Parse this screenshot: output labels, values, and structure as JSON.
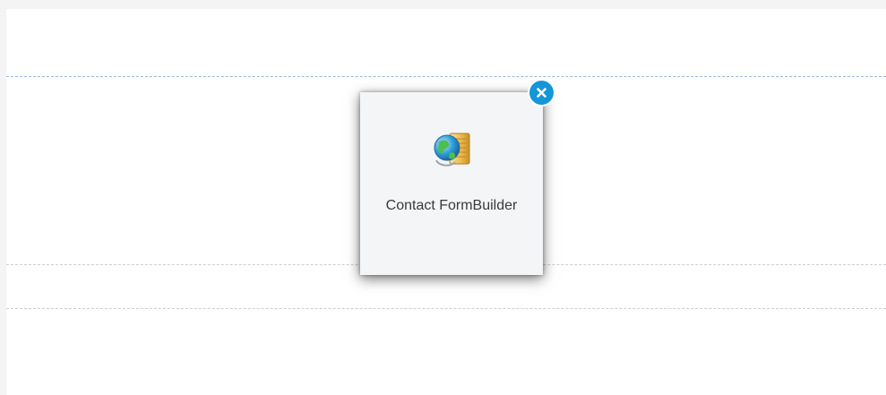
{
  "workspace": {
    "tile": {
      "label": "Contact FormBuilder",
      "icon": "contact-form-builder-icon"
    },
    "close_button": {
      "icon": "close-icon",
      "color": "#1596d8"
    }
  }
}
